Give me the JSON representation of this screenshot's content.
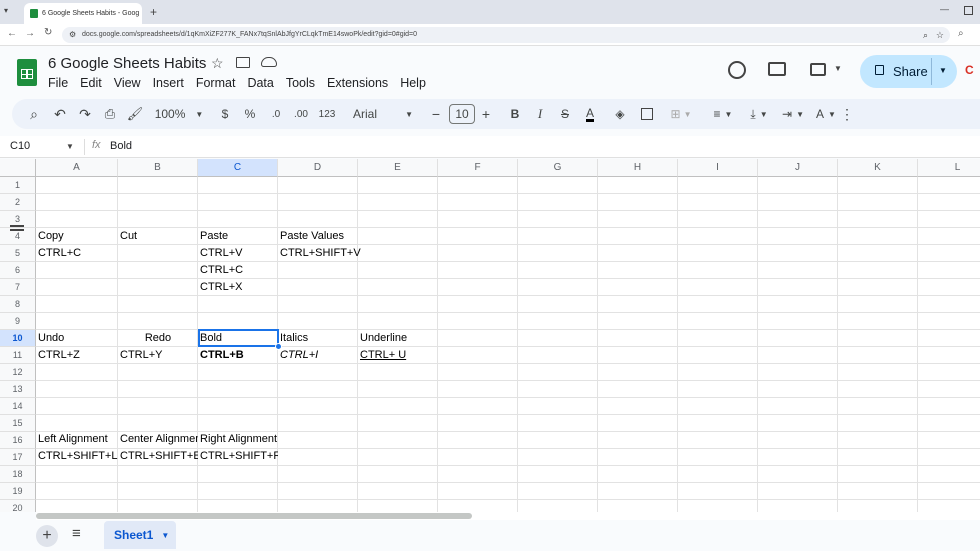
{
  "browser": {
    "tab_title": "6 Google Sheets Habits - Goog",
    "url": "docs.google.com/spreadsheets/d/1qKmXiZF277K_FANx7tqSnlAbJfgYrCLqkTmE14swoPk/edit?gid=0#gid=0"
  },
  "doc": {
    "title": "6 Google Sheets Habits",
    "menu": [
      "File",
      "Edit",
      "View",
      "Insert",
      "Format",
      "Data",
      "Tools",
      "Extensions",
      "Help"
    ],
    "share_label": "Share"
  },
  "toolbar": {
    "zoom": "100%",
    "currency": "$",
    "percent": "%",
    "dec_less": ".0",
    "dec_more": ".00",
    "number_format": "123",
    "font": "Arial",
    "font_size": "10",
    "bold": "B",
    "italic": "I",
    "strike": "S",
    "text_color": "A",
    "text_color_value": "#000000"
  },
  "formula_bar": {
    "name_box": "C10",
    "fx": "fx",
    "content": "Bold"
  },
  "grid": {
    "columns": [
      "A",
      "B",
      "C",
      "D",
      "E",
      "F",
      "G",
      "H",
      "I",
      "J",
      "K",
      "L"
    ],
    "rows": [
      "1",
      "2",
      "3",
      "4",
      "5",
      "6",
      "7",
      "8",
      "9",
      "10",
      "11",
      "12",
      "13",
      "14",
      "15",
      "16",
      "17",
      "18",
      "19",
      "20"
    ],
    "selected_cell": "C10",
    "cells": {
      "A4": "Copy",
      "B4": "Cut",
      "C4": "Paste",
      "D4": "Paste Values",
      "A5": "CTRL+C",
      "C5": "CTRL+V",
      "D5": "CTRL+SHIFT+V",
      "C6": "CTRL+C",
      "C7": "CTRL+X",
      "A10": "Undo",
      "B10": "Redo",
      "C10": "Bold",
      "D10": "Italics",
      "E10": "Underline",
      "A11": "CTRL+Z",
      "B11": "CTRL+Y",
      "C11": "CTRL+B",
      "D11": "CTRL+I",
      "E11": "CTRL+ U",
      "A16": "Left Alignment",
      "B16": "Center Alignmen",
      "C16": "Right Alignment",
      "A17": "CTRL+SHIFT+L",
      "B17": "CTRL+SHIFT+E",
      "C17": "CTRL+SHIFT+R"
    }
  },
  "sheets": {
    "active": "Sheet1"
  },
  "colors": {
    "accent": "#0b57d0",
    "share_bg": "#c2e7ff",
    "selection": "#1a73e8"
  }
}
